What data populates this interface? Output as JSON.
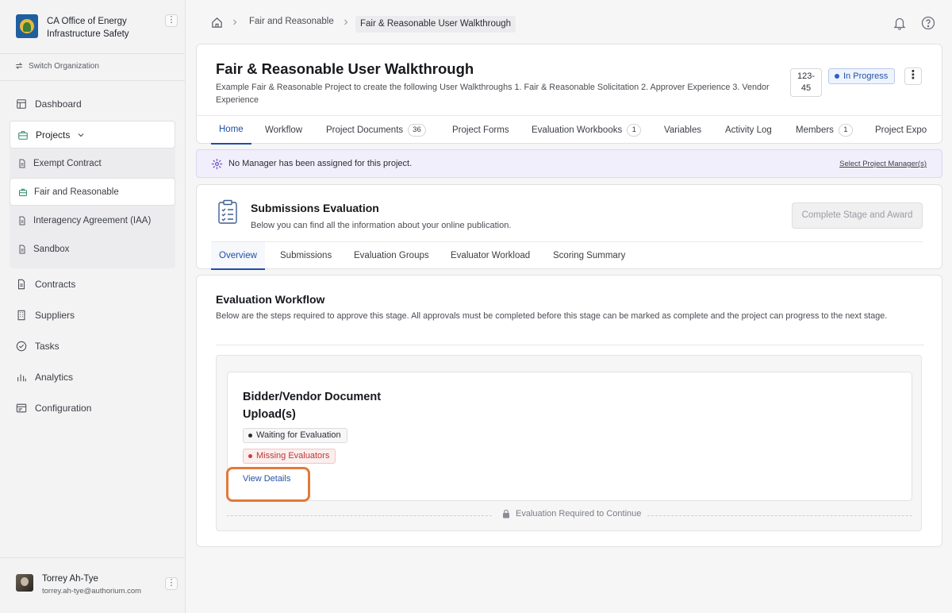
{
  "org": {
    "name": "CA Office of Energy Infrastructure Safety",
    "menu": "⋮"
  },
  "switch_org": "Switch Organization",
  "nav": {
    "dashboard": "Dashboard",
    "projects": "Projects",
    "project_items": [
      "Exempt Contract",
      "Fair and Reasonable",
      "Interagency Agreement (IAA)",
      "Sandbox"
    ],
    "contracts": "Contracts",
    "suppliers": "Suppliers",
    "tasks": "Tasks",
    "analytics": "Analytics",
    "configuration": "Configuration"
  },
  "user": {
    "name": "Torrey Ah-Tye",
    "email": "torrey.ah-tye@authorium.com",
    "menu": "⋮"
  },
  "breadcrumb": {
    "parent": "Fair and Reasonable",
    "current": "Fair & Reasonable User Walkthrough"
  },
  "project": {
    "title": "Fair & Reasonable User Walkthrough",
    "description": "Example Fair & Reasonable Project to create the following User Walkthroughs 1. Fair & Reasonable Solicitation 2. Approver Experience 3. Vendor Experience",
    "id_line1": "123-",
    "id_line2": "45",
    "status": "In Progress",
    "more": "⋮",
    "status_color": "#2b5fd0"
  },
  "tabs": [
    {
      "label": "Home"
    },
    {
      "label": "Workflow"
    },
    {
      "label": "Project Documents",
      "count": "36"
    },
    {
      "label": "Project Forms"
    },
    {
      "label": "Evaluation Workbooks",
      "count": "1"
    },
    {
      "label": "Variables"
    },
    {
      "label": "Activity Log"
    },
    {
      "label": "Members",
      "count": "1"
    },
    {
      "label": "Project Expo"
    }
  ],
  "banner": {
    "text": "No Manager has been assigned for this project.",
    "link": "Select Project Manager(s)"
  },
  "stage": {
    "title": "Submissions Evaluation",
    "description": "Below you can find all the information about your online publication.",
    "complete_button": "Complete Stage and Award",
    "tabs": [
      "Overview",
      "Submissions",
      "Evaluation Groups",
      "Evaluator Workload",
      "Scoring Summary"
    ]
  },
  "workflow": {
    "title": "Evaluation Workflow",
    "description": "Below are the steps required to approve this stage. All approvals must be completed before this stage can be marked as complete and the project can progress to the next stage.",
    "step": {
      "title": "Bidder/Vendor Document Upload(s)",
      "status_1": "Waiting for Evaluation",
      "status_2": "Missing Evaluators",
      "link": "View Details"
    },
    "requirement": "Evaluation Required to Continue"
  },
  "colors": {
    "accent": "#1f4fa3",
    "highlight": "#e07a3b",
    "danger": "#c03535"
  }
}
